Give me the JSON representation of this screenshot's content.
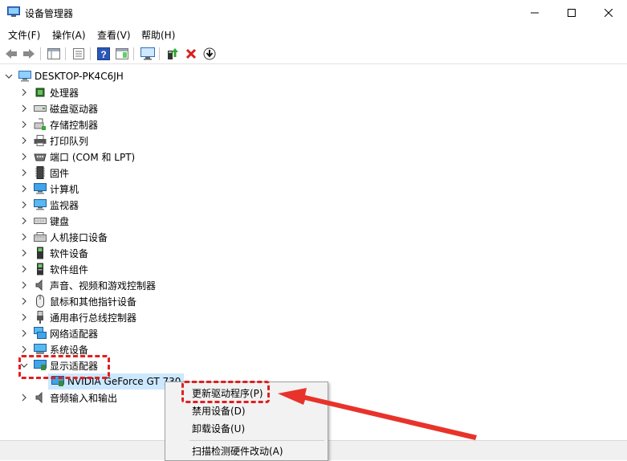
{
  "window": {
    "title": "设备管理器"
  },
  "menubar": {
    "items": [
      "文件(F)",
      "操作(A)",
      "查看(V)",
      "帮助(H)"
    ]
  },
  "tree": {
    "root": "DESKTOP-PK4C6JH",
    "categories": [
      {
        "label": "处理器",
        "icon": "cpu-icon"
      },
      {
        "label": "磁盘驱动器",
        "icon": "disk-icon"
      },
      {
        "label": "存储控制器",
        "icon": "storage-controller-icon"
      },
      {
        "label": "打印队列",
        "icon": "printer-icon"
      },
      {
        "label": "端口 (COM 和 LPT)",
        "icon": "port-icon"
      },
      {
        "label": "固件",
        "icon": "firmware-icon"
      },
      {
        "label": "计算机",
        "icon": "computer-icon"
      },
      {
        "label": "监视器",
        "icon": "monitor-icon"
      },
      {
        "label": "键盘",
        "icon": "keyboard-icon"
      },
      {
        "label": "人机接口设备",
        "icon": "hid-icon"
      },
      {
        "label": "软件设备",
        "icon": "software-device-icon"
      },
      {
        "label": "软件组件",
        "icon": "software-component-icon"
      },
      {
        "label": "声音、视频和游戏控制器",
        "icon": "speaker-icon"
      },
      {
        "label": "鼠标和其他指针设备",
        "icon": "mouse-icon"
      },
      {
        "label": "通用串行总线控制器",
        "icon": "usb-icon"
      },
      {
        "label": "网络适配器",
        "icon": "network-icon"
      },
      {
        "label": "系统设备",
        "icon": "system-device-icon"
      },
      {
        "label": "显示适配器",
        "icon": "display-adapter-icon"
      },
      {
        "label": "音频输入和输出",
        "icon": "audio-io-icon"
      }
    ],
    "expanded_child": "NVIDIA GeForce GT 730"
  },
  "context_menu": {
    "update_driver": "更新驱动程序(P)",
    "disable": "禁用设备(D)",
    "uninstall": "卸载设备(U)",
    "scan": "扫描检测硬件改动(A)"
  },
  "colors": {
    "highlight": "#e02020",
    "selection": "#cce8ff",
    "accent": "#1f6fd0"
  }
}
